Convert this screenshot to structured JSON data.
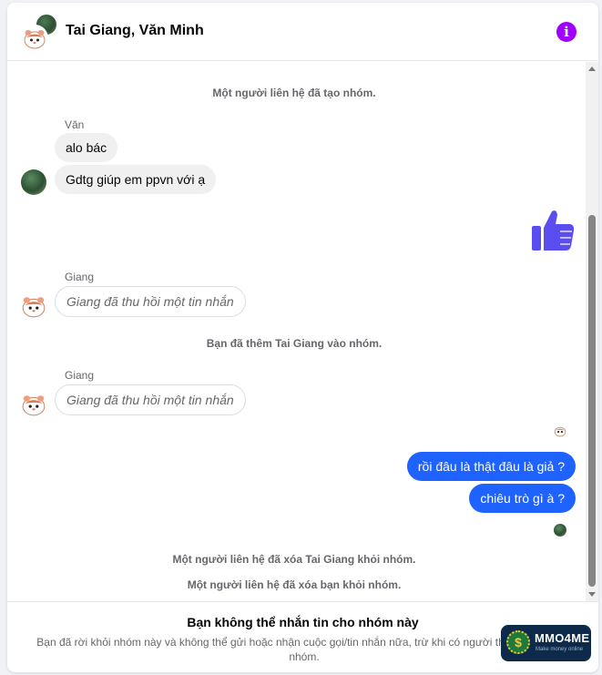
{
  "header": {
    "title": "Tai Giang, Văn Minh",
    "info_icon": "info-icon",
    "info_glyph": "i"
  },
  "messages": {
    "sys_created": "Một người liên hệ đã tạo nhóm.",
    "sender_van": "Văn",
    "van_msg1": "alo bác",
    "van_msg2": "Gdtg giúp em ppvn với ạ",
    "like_icon": "thumbs-up-icon",
    "sender_giang1": "Giang",
    "recalled1": "Giang đã thu hồi một tin nhắn",
    "sys_added": "Bạn đã thêm Tai Giang vào nhóm.",
    "sender_giang2": "Giang",
    "recalled2": "Giang đã thu hồi một tin nhắn",
    "out_msg1": "rồi đâu là thật đâu là giả ?",
    "out_msg2": "chiêu trò gì à ?",
    "sys_removed_tai": "Một người liên hệ đã xóa Tai Giang khỏi nhóm.",
    "sys_removed_you": "Một người liên hệ đã xóa bạn khỏi nhóm."
  },
  "footer": {
    "title": "Bạn không thể nhắn tin cho nhóm này",
    "description": "Bạn đã rời khỏi nhóm này và không thể gửi hoặc nhận cuộc gọi/tin nhắn nữa, trừ khi có người thêm bạn trở lại nhóm."
  },
  "watermark": {
    "brand": "MMO4ME",
    "tagline": "Make money online",
    "coin_glyph": "$"
  },
  "colors": {
    "accent": "#1e63ff",
    "info": "#a000ff",
    "like": "#5b4ef0"
  }
}
